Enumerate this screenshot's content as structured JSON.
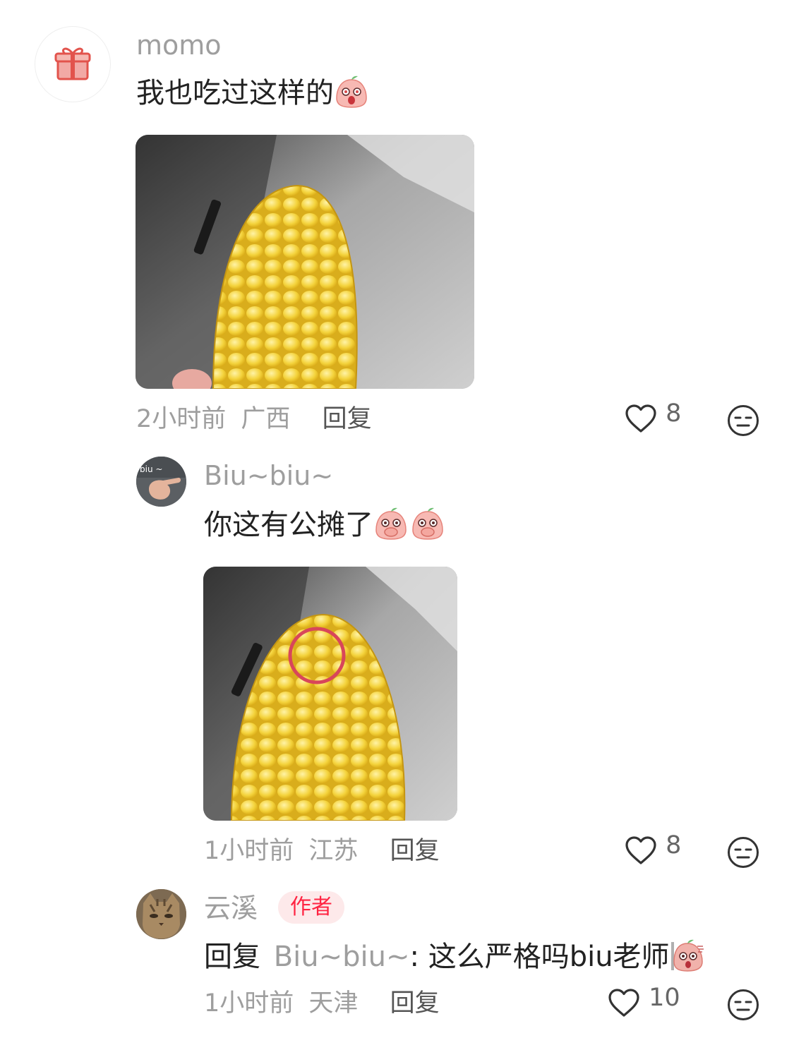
{
  "comments": [
    {
      "username": "momo",
      "text": "我也吃过这样的",
      "time": "2小时前",
      "location": "广西",
      "reply_label": "回复",
      "likes": "8"
    },
    {
      "username": "Biu~biu~",
      "avatar_text": "biu ~",
      "text": "你这有公摊了",
      "time": "1小时前",
      "location": "江苏",
      "reply_label": "回复",
      "likes": "8"
    },
    {
      "username": "云溪",
      "badge": "作者",
      "reply_prefix": "回复",
      "mention": "Biu~biu~",
      "text": ": 这么严格吗biu老师",
      "time": "1小时前",
      "location": "天津",
      "reply_label": "回复",
      "likes": "10"
    }
  ],
  "colors": {
    "accent": "#ff2442",
    "badge_bg": "#fde9ea",
    "corn": "#f2cc2e"
  },
  "icons": [
    "gift-icon",
    "heart-icon",
    "emoji-face-icon"
  ]
}
